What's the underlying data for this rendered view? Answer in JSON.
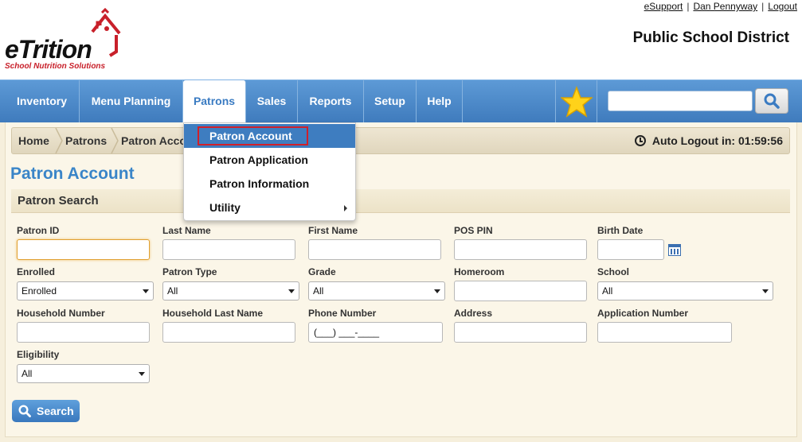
{
  "header": {
    "logo_text": "eTrition",
    "logo_sub": "School Nutrition Solutions",
    "links": [
      "eSupport",
      "Dan Pennyway",
      "Logout"
    ],
    "district": "Public School District"
  },
  "nav": {
    "items": [
      "Inventory",
      "Menu Planning",
      "Patrons",
      "Sales",
      "Reports",
      "Setup",
      "Help"
    ],
    "active": "Patrons",
    "search_placeholder": ""
  },
  "patrons_menu": {
    "items": [
      "Patron Account",
      "Patron Application",
      "Patron Information",
      "Utility"
    ]
  },
  "breadcrumb": {
    "items": [
      "Home",
      "Patrons",
      "Patron Acco"
    ],
    "auto_logout_label": "Auto Logout in:",
    "auto_logout_time": "01:59:56"
  },
  "page": {
    "title": "Patron Account",
    "section": "Patron Search"
  },
  "form": {
    "patron_id": "Patron ID",
    "last_name": "Last Name",
    "first_name": "First Name",
    "pos_pin": "POS PIN",
    "birth_date": "Birth Date",
    "enrolled": "Enrolled",
    "enrolled_value": "Enrolled",
    "patron_type": "Patron Type",
    "patron_type_value": "All",
    "grade": "Grade",
    "grade_value": "All",
    "homeroom": "Homeroom",
    "school": "School",
    "school_value": "All",
    "household_number": "Household Number",
    "household_last_name": "Household Last Name",
    "phone_number": "Phone Number",
    "phone_value": "(___) ___-____",
    "address": "Address",
    "application_number": "Application Number",
    "eligibility": "Eligibility",
    "eligibility_value": "All",
    "search_button": "Search"
  },
  "colors": {
    "nav_blue": "#4a88c8",
    "title_blue": "#3a85c8",
    "menu_highlight": "#3e7dc0",
    "logo_red": "#c8202a"
  }
}
